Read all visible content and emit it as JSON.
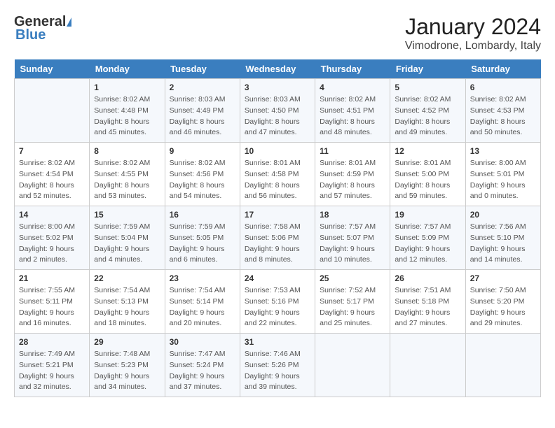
{
  "header": {
    "logo_general": "General",
    "logo_blue": "Blue",
    "month_title": "January 2024",
    "location": "Vimodrone, Lombardy, Italy"
  },
  "days_of_week": [
    "Sunday",
    "Monday",
    "Tuesday",
    "Wednesday",
    "Thursday",
    "Friday",
    "Saturday"
  ],
  "weeks": [
    [
      {
        "day": "",
        "info": ""
      },
      {
        "day": "1",
        "info": "Sunrise: 8:02 AM\nSunset: 4:48 PM\nDaylight: 8 hours\nand 45 minutes."
      },
      {
        "day": "2",
        "info": "Sunrise: 8:03 AM\nSunset: 4:49 PM\nDaylight: 8 hours\nand 46 minutes."
      },
      {
        "day": "3",
        "info": "Sunrise: 8:03 AM\nSunset: 4:50 PM\nDaylight: 8 hours\nand 47 minutes."
      },
      {
        "day": "4",
        "info": "Sunrise: 8:02 AM\nSunset: 4:51 PM\nDaylight: 8 hours\nand 48 minutes."
      },
      {
        "day": "5",
        "info": "Sunrise: 8:02 AM\nSunset: 4:52 PM\nDaylight: 8 hours\nand 49 minutes."
      },
      {
        "day": "6",
        "info": "Sunrise: 8:02 AM\nSunset: 4:53 PM\nDaylight: 8 hours\nand 50 minutes."
      }
    ],
    [
      {
        "day": "7",
        "info": "Sunrise: 8:02 AM\nSunset: 4:54 PM\nDaylight: 8 hours\nand 52 minutes."
      },
      {
        "day": "8",
        "info": "Sunrise: 8:02 AM\nSunset: 4:55 PM\nDaylight: 8 hours\nand 53 minutes."
      },
      {
        "day": "9",
        "info": "Sunrise: 8:02 AM\nSunset: 4:56 PM\nDaylight: 8 hours\nand 54 minutes."
      },
      {
        "day": "10",
        "info": "Sunrise: 8:01 AM\nSunset: 4:58 PM\nDaylight: 8 hours\nand 56 minutes."
      },
      {
        "day": "11",
        "info": "Sunrise: 8:01 AM\nSunset: 4:59 PM\nDaylight: 8 hours\nand 57 minutes."
      },
      {
        "day": "12",
        "info": "Sunrise: 8:01 AM\nSunset: 5:00 PM\nDaylight: 8 hours\nand 59 minutes."
      },
      {
        "day": "13",
        "info": "Sunrise: 8:00 AM\nSunset: 5:01 PM\nDaylight: 9 hours\nand 0 minutes."
      }
    ],
    [
      {
        "day": "14",
        "info": "Sunrise: 8:00 AM\nSunset: 5:02 PM\nDaylight: 9 hours\nand 2 minutes."
      },
      {
        "day": "15",
        "info": "Sunrise: 7:59 AM\nSunset: 5:04 PM\nDaylight: 9 hours\nand 4 minutes."
      },
      {
        "day": "16",
        "info": "Sunrise: 7:59 AM\nSunset: 5:05 PM\nDaylight: 9 hours\nand 6 minutes."
      },
      {
        "day": "17",
        "info": "Sunrise: 7:58 AM\nSunset: 5:06 PM\nDaylight: 9 hours\nand 8 minutes."
      },
      {
        "day": "18",
        "info": "Sunrise: 7:57 AM\nSunset: 5:07 PM\nDaylight: 9 hours\nand 10 minutes."
      },
      {
        "day": "19",
        "info": "Sunrise: 7:57 AM\nSunset: 5:09 PM\nDaylight: 9 hours\nand 12 minutes."
      },
      {
        "day": "20",
        "info": "Sunrise: 7:56 AM\nSunset: 5:10 PM\nDaylight: 9 hours\nand 14 minutes."
      }
    ],
    [
      {
        "day": "21",
        "info": "Sunrise: 7:55 AM\nSunset: 5:11 PM\nDaylight: 9 hours\nand 16 minutes."
      },
      {
        "day": "22",
        "info": "Sunrise: 7:54 AM\nSunset: 5:13 PM\nDaylight: 9 hours\nand 18 minutes."
      },
      {
        "day": "23",
        "info": "Sunrise: 7:54 AM\nSunset: 5:14 PM\nDaylight: 9 hours\nand 20 minutes."
      },
      {
        "day": "24",
        "info": "Sunrise: 7:53 AM\nSunset: 5:16 PM\nDaylight: 9 hours\nand 22 minutes."
      },
      {
        "day": "25",
        "info": "Sunrise: 7:52 AM\nSunset: 5:17 PM\nDaylight: 9 hours\nand 25 minutes."
      },
      {
        "day": "26",
        "info": "Sunrise: 7:51 AM\nSunset: 5:18 PM\nDaylight: 9 hours\nand 27 minutes."
      },
      {
        "day": "27",
        "info": "Sunrise: 7:50 AM\nSunset: 5:20 PM\nDaylight: 9 hours\nand 29 minutes."
      }
    ],
    [
      {
        "day": "28",
        "info": "Sunrise: 7:49 AM\nSunset: 5:21 PM\nDaylight: 9 hours\nand 32 minutes."
      },
      {
        "day": "29",
        "info": "Sunrise: 7:48 AM\nSunset: 5:23 PM\nDaylight: 9 hours\nand 34 minutes."
      },
      {
        "day": "30",
        "info": "Sunrise: 7:47 AM\nSunset: 5:24 PM\nDaylight: 9 hours\nand 37 minutes."
      },
      {
        "day": "31",
        "info": "Sunrise: 7:46 AM\nSunset: 5:26 PM\nDaylight: 9 hours\nand 39 minutes."
      },
      {
        "day": "",
        "info": ""
      },
      {
        "day": "",
        "info": ""
      },
      {
        "day": "",
        "info": ""
      }
    ]
  ]
}
